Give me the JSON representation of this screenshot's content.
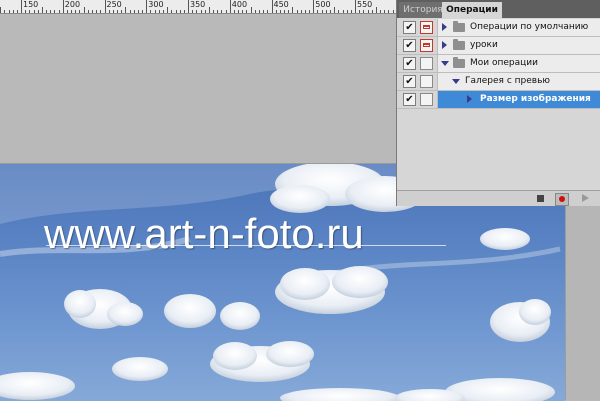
{
  "ruler": {
    "labels": [
      "150",
      "200",
      "250",
      "300",
      "350",
      "400",
      "450",
      "500",
      "550"
    ]
  },
  "canvas": {
    "watermark": "www.art-n-foto.ru"
  },
  "panel": {
    "tabs": [
      {
        "label": "История"
      },
      {
        "label": "Операции"
      }
    ],
    "actions": [
      {
        "name": "Операции по умолчанию",
        "checked": true,
        "expanded": false
      },
      {
        "name": "уроки",
        "checked": true,
        "expanded": false
      },
      {
        "name": "Мои операции",
        "checked": true,
        "expanded": true
      },
      {
        "name": "Галерея с превью",
        "checked": true,
        "expanded": true
      },
      {
        "name": "Размер изображения",
        "checked": true,
        "expanded": false,
        "selected": true
      }
    ],
    "icons": {
      "stop": "stop-icon",
      "record": "record-icon",
      "play": "play-icon"
    },
    "colors": {
      "selection": "#3f8ad6",
      "record": "#d01010"
    }
  }
}
